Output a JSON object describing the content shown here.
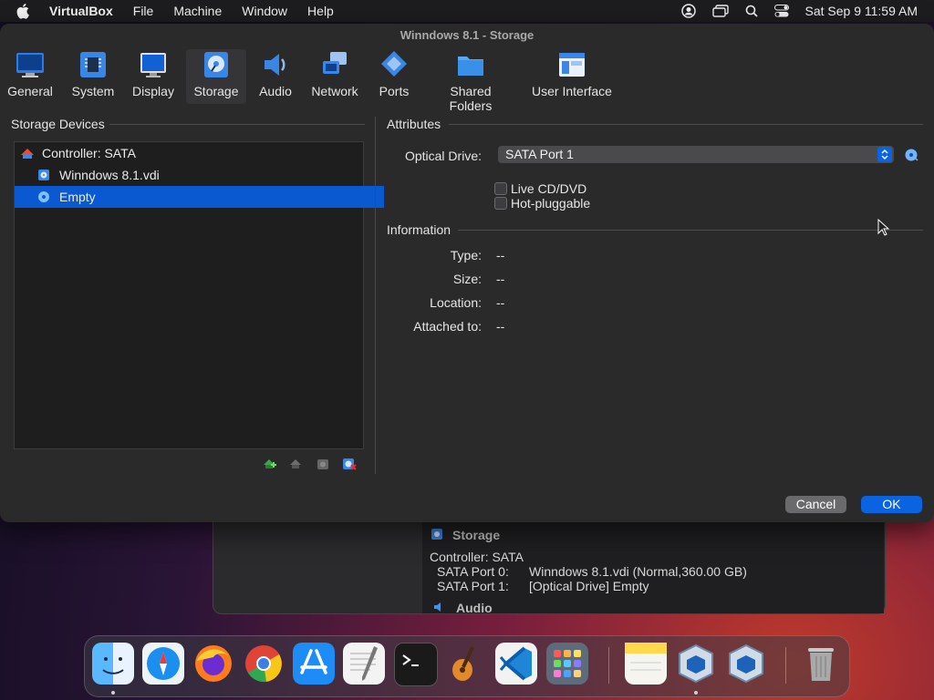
{
  "menubar": {
    "app": "VirtualBox",
    "items": [
      "File",
      "Machine",
      "Window",
      "Help"
    ],
    "datetime": "Sat Sep 9  11:59 AM"
  },
  "dialog": {
    "title": "Winndows 8.1 - Storage",
    "toolbar": [
      {
        "label": "General",
        "icon": "monitor-icon"
      },
      {
        "label": "System",
        "icon": "chip-icon"
      },
      {
        "label": "Display",
        "icon": "display-icon"
      },
      {
        "label": "Storage",
        "icon": "disk-icon",
        "selected": true
      },
      {
        "label": "Audio",
        "icon": "speaker-icon"
      },
      {
        "label": "Network",
        "icon": "network-icon"
      },
      {
        "label": "Ports",
        "icon": "plug-icon"
      },
      {
        "label": "Shared Folders",
        "icon": "folder-icon"
      },
      {
        "label": "User Interface",
        "icon": "window-icon"
      }
    ],
    "storage_devices": {
      "header": "Storage Devices",
      "tree": [
        {
          "label": "Controller: SATA",
          "icon": "controller-icon"
        },
        {
          "label": "Winndows 8.1.vdi",
          "icon": "hdd-icon"
        },
        {
          "label": "Empty",
          "icon": "optical-icon",
          "selected": true
        }
      ]
    },
    "attributes": {
      "header": "Attributes",
      "optical_drive_label": "Optical Drive:",
      "optical_drive_value": "SATA Port 1",
      "live_cd": "Live CD/DVD",
      "hot_pluggable": "Hot-pluggable"
    },
    "information": {
      "header": "Information",
      "rows": [
        {
          "label": "Type:",
          "value": "--"
        },
        {
          "label": "Size:",
          "value": "--"
        },
        {
          "label": "Location:",
          "value": "--"
        },
        {
          "label": "Attached to:",
          "value": "--"
        }
      ]
    },
    "buttons": {
      "cancel": "Cancel",
      "ok": "OK"
    },
    "accent": "#0a63e0"
  },
  "background_window": {
    "section": "Storage",
    "controller": "Controller: SATA",
    "port0_label": "SATA Port 0:",
    "port0_value": "Winndows 8.1.vdi (Normal,360.00 GB)",
    "port1_label": "SATA Port 1:",
    "port1_value": "[Optical Drive] Empty",
    "next_section": "Audio"
  },
  "dock": [
    "finder-icon",
    "safari-icon",
    "firefox-icon",
    "chrome-icon",
    "appstore-icon",
    "textedit-icon",
    "terminal-icon",
    "garageband-icon",
    "vscode-icon",
    "launchpad-icon",
    "notes-icon",
    "virtualbox-icon",
    "virtualbox-vm-icon",
    "trash-icon"
  ]
}
